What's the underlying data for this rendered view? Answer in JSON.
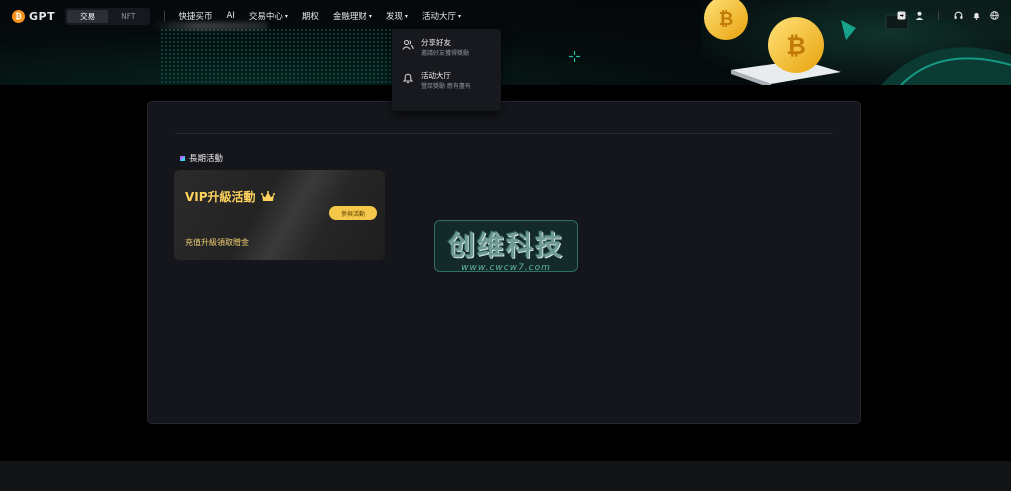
{
  "brand": {
    "name": "GPT",
    "coin_symbol": "₿"
  },
  "mode_switch": {
    "options": [
      "交易",
      "NFT"
    ],
    "active": "交易"
  },
  "nav": {
    "items": [
      {
        "label": "快捷买币",
        "has_caret": false
      },
      {
        "label": "AI",
        "has_caret": false
      },
      {
        "label": "交易中心",
        "has_caret": true
      },
      {
        "label": "期权",
        "has_caret": false
      },
      {
        "label": "金融理财",
        "has_caret": true
      },
      {
        "label": "发现",
        "has_caret": true
      },
      {
        "label": "活动大厅",
        "has_caret": true
      }
    ],
    "caret_symbol": "▾",
    "right_icons": [
      "download-icon",
      "user-icon",
      "headset-icon",
      "bell-icon",
      "globe-icon"
    ]
  },
  "dropdown": {
    "items": [
      {
        "title": "分享好友",
        "subtitle": "邀請好友獲得獎勵",
        "icon": "users-icon"
      },
      {
        "title": "活动大厅",
        "subtitle": "豐厚獎勵 應有盡有",
        "icon": "bell-icon"
      }
    ]
  },
  "section": {
    "title": "長期活動"
  },
  "card": {
    "title": "VIP升級活動",
    "button": "參與活動",
    "description": "充值升級領取贈金"
  },
  "watermark": {
    "text": "创维科技",
    "url": "www.cwcw7.com"
  },
  "colors": {
    "accent_gold": "#ffd35c",
    "button_gold": "#f4c84a",
    "bitcoin_orange": "#f7931a",
    "teal": "#19c2a5"
  }
}
